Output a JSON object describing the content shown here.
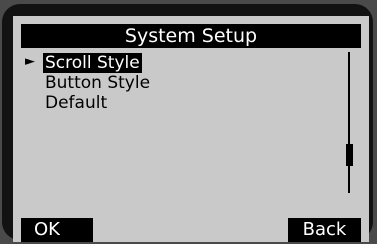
{
  "title": "System Setup",
  "selector_glyph": "►",
  "menu": {
    "items": [
      {
        "label": "Scroll Style",
        "selected": true
      },
      {
        "label": "Button Style",
        "selected": false
      },
      {
        "label": "Default",
        "selected": false
      }
    ]
  },
  "softkeys": {
    "left_label": "OK",
    "right_label": "Back"
  },
  "scrollbar": {
    "position_fraction": 0.65
  },
  "colors": {
    "screen_bg": "#c9c9c9",
    "bezel": "#121212",
    "ink": "#000000",
    "inverse_text": "#ffffff"
  }
}
